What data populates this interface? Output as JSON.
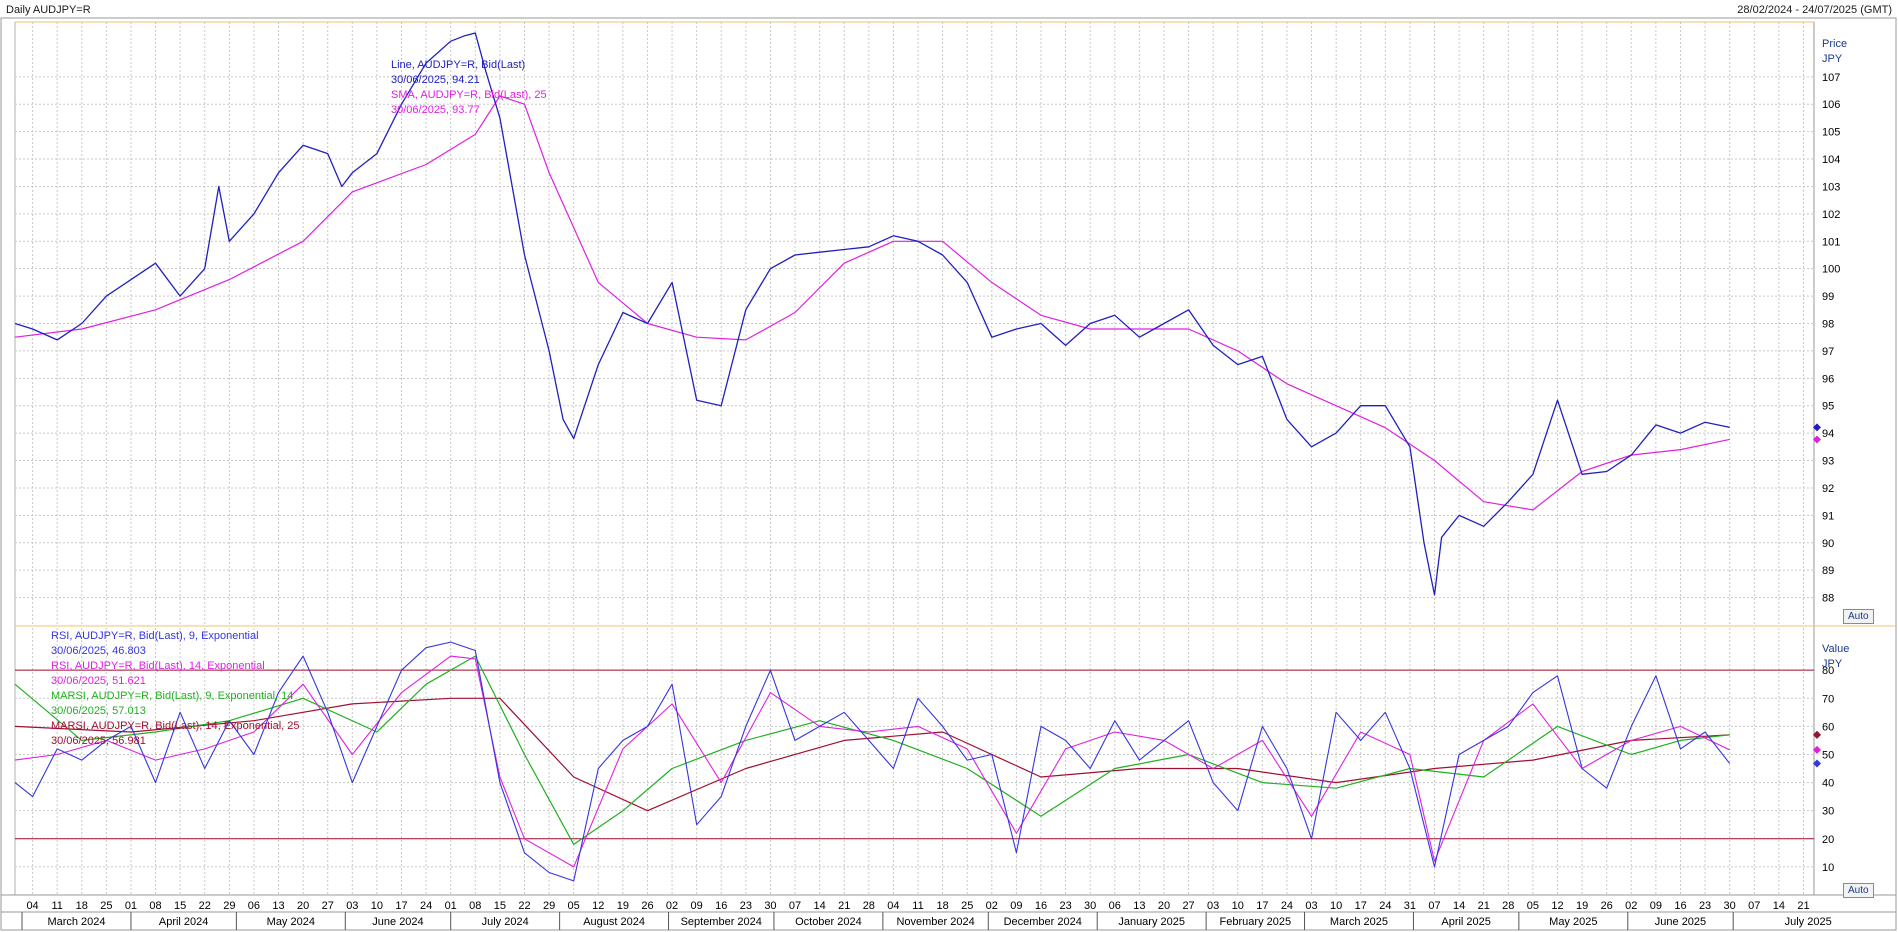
{
  "header": {
    "symbol_title": "Daily AUDJPY=R",
    "date_range": "28/02/2024 - 24/07/2025 (GMT)"
  },
  "controls": {
    "auto_label_price": "Auto",
    "auto_label_value": "Auto"
  },
  "colors": {
    "price_line": "#2020c0",
    "sma": "#e020e0",
    "rsi9": "#3535e0",
    "rsi14": "#e020e0",
    "marsi9": "#20b020",
    "marsi14": "#a01030",
    "band_line": "#a01030",
    "price_marker": "#2020c0",
    "sma_marker": "#e020e0",
    "frame_top": "#f0c070",
    "grid": "#c8c8c8"
  },
  "chart_data": [
    {
      "type": "line",
      "title": "Daily AUDJPY=R",
      "ylabel": "Price",
      "yunit": "JPY",
      "ylim": [
        87.0,
        109.0
      ],
      "yticks": [
        88,
        89,
        90,
        91,
        92,
        93,
        94,
        95,
        96,
        97,
        98,
        99,
        100,
        101,
        102,
        103,
        104,
        105,
        106,
        107
      ],
      "grid": true,
      "legend": [
        {
          "name": "Line, AUDJPY=R, Bid(Last)",
          "date": "30/06/2025",
          "value": "94.21"
        },
        {
          "name": "SMA, AUDJPY=R, Bid(Last),  25",
          "date": "30/06/2025",
          "value": "93.77"
        }
      ],
      "series": [
        {
          "name": "Line, AUDJPY=R, Bid(Last)",
          "x": [
            "2024-02-28",
            "2024-03-04",
            "2024-03-11",
            "2024-03-18",
            "2024-03-25",
            "2024-04-01",
            "2024-04-08",
            "2024-04-15",
            "2024-04-22",
            "2024-04-26",
            "2024-04-29",
            "2024-05-06",
            "2024-05-13",
            "2024-05-20",
            "2024-05-27",
            "2024-05-31",
            "2024-06-03",
            "2024-06-10",
            "2024-06-17",
            "2024-06-24",
            "2024-07-01",
            "2024-07-05",
            "2024-07-08",
            "2024-07-11",
            "2024-07-15",
            "2024-07-22",
            "2024-07-29",
            "2024-08-02",
            "2024-08-05",
            "2024-08-12",
            "2024-08-19",
            "2024-08-26",
            "2024-09-02",
            "2024-09-09",
            "2024-09-16",
            "2024-09-23",
            "2024-09-30",
            "2024-10-07",
            "2024-10-14",
            "2024-10-21",
            "2024-10-28",
            "2024-11-04",
            "2024-11-11",
            "2024-11-18",
            "2024-11-25",
            "2024-12-02",
            "2024-12-09",
            "2024-12-16",
            "2024-12-23",
            "2024-12-30",
            "2025-01-06",
            "2025-01-13",
            "2025-01-20",
            "2025-01-27",
            "2025-02-03",
            "2025-02-10",
            "2025-02-17",
            "2025-02-24",
            "2025-03-03",
            "2025-03-10",
            "2025-03-17",
            "2025-03-24",
            "2025-03-31",
            "2025-04-04",
            "2025-04-07",
            "2025-04-09",
            "2025-04-14",
            "2025-04-21",
            "2025-04-28",
            "2025-05-05",
            "2025-05-12",
            "2025-05-19",
            "2025-05-26",
            "2025-06-02",
            "2025-06-09",
            "2025-06-16",
            "2025-06-23",
            "2025-06-30"
          ],
          "values": [
            98.0,
            97.8,
            97.4,
            98.0,
            99.0,
            99.6,
            100.2,
            99.0,
            100.0,
            103.0,
            101.0,
            102.0,
            103.5,
            104.5,
            104.2,
            103.0,
            103.5,
            104.2,
            106.0,
            107.5,
            108.3,
            108.5,
            108.6,
            107.2,
            105.5,
            100.5,
            97.0,
            94.5,
            93.8,
            96.5,
            98.4,
            98.0,
            99.5,
            95.2,
            95.0,
            98.5,
            100.0,
            100.5,
            100.6,
            100.7,
            100.8,
            101.2,
            101.0,
            100.5,
            99.5,
            97.5,
            97.8,
            98.0,
            97.2,
            98.0,
            98.3,
            97.5,
            98.0,
            98.5,
            97.2,
            96.5,
            96.8,
            94.5,
            93.5,
            94.0,
            95.0,
            95.0,
            93.5,
            90.0,
            88.1,
            90.2,
            91.0,
            90.6,
            91.5,
            92.5,
            95.2,
            92.5,
            92.6,
            93.2,
            94.3,
            94.0,
            94.4,
            94.21
          ]
        },
        {
          "name": "SMA, AUDJPY=R, Bid(Last),  25",
          "x": [
            "2024-02-28",
            "2024-03-18",
            "2024-04-08",
            "2024-04-29",
            "2024-05-20",
            "2024-06-03",
            "2024-06-24",
            "2024-07-08",
            "2024-07-15",
            "2024-07-22",
            "2024-07-29",
            "2024-08-12",
            "2024-08-26",
            "2024-09-09",
            "2024-09-23",
            "2024-10-07",
            "2024-10-21",
            "2024-11-04",
            "2024-11-18",
            "2024-12-02",
            "2024-12-16",
            "2024-12-30",
            "2025-01-13",
            "2025-01-27",
            "2025-02-10",
            "2025-02-24",
            "2025-03-10",
            "2025-03-24",
            "2025-04-07",
            "2025-04-21",
            "2025-05-05",
            "2025-05-19",
            "2025-06-02",
            "2025-06-16",
            "2025-06-30"
          ],
          "values": [
            97.5,
            97.8,
            98.5,
            99.6,
            101.0,
            102.8,
            103.8,
            104.9,
            106.3,
            106.0,
            103.5,
            99.5,
            98.0,
            97.5,
            97.4,
            98.4,
            100.2,
            101.0,
            101.0,
            99.5,
            98.3,
            97.8,
            97.8,
            97.8,
            97.0,
            95.8,
            95.0,
            94.2,
            93.0,
            91.5,
            91.2,
            92.6,
            93.2,
            93.4,
            93.77
          ]
        }
      ]
    },
    {
      "type": "line",
      "title": "",
      "ylabel": "Value",
      "yunit": "JPY",
      "ylim": [
        0,
        95
      ],
      "yticks": [
        10,
        20,
        30,
        40,
        50,
        60,
        70,
        80
      ],
      "reference_lines": [
        20,
        80
      ],
      "grid": true,
      "legend": [
        {
          "name": "RSI, AUDJPY=R, Bid(Last),  9, Exponential",
          "date": "30/06/2025",
          "value": "46.803"
        },
        {
          "name": "RSI, AUDJPY=R, Bid(Last),  14, Exponential",
          "date": "30/06/2025",
          "value": "51.621"
        },
        {
          "name": "MARSI, AUDJPY=R, Bid(Last),  9, Exponential, 14",
          "date": "30/06/2025",
          "value": "57.013"
        },
        {
          "name": "MARSI, AUDJPY=R, Bid(Last),  14, Exponential, 25",
          "date": "30/06/2025",
          "value": "56.981"
        }
      ],
      "series": [
        {
          "name": "RSI, AUDJPY=R, Bid(Last),  9, Exponential",
          "x": [
            "2024-02-28",
            "2024-03-04",
            "2024-03-11",
            "2024-03-18",
            "2024-03-25",
            "2024-04-01",
            "2024-04-08",
            "2024-04-15",
            "2024-04-22",
            "2024-04-29",
            "2024-05-06",
            "2024-05-13",
            "2024-05-20",
            "2024-05-27",
            "2024-06-03",
            "2024-06-10",
            "2024-06-17",
            "2024-06-24",
            "2024-07-01",
            "2024-07-08",
            "2024-07-15",
            "2024-07-22",
            "2024-07-29",
            "2024-08-05",
            "2024-08-12",
            "2024-08-19",
            "2024-08-26",
            "2024-09-02",
            "2024-09-09",
            "2024-09-16",
            "2024-09-23",
            "2024-09-30",
            "2024-10-07",
            "2024-10-14",
            "2024-10-21",
            "2024-10-28",
            "2024-11-04",
            "2024-11-11",
            "2024-11-18",
            "2024-11-25",
            "2024-12-02",
            "2024-12-09",
            "2024-12-16",
            "2024-12-23",
            "2024-12-30",
            "2025-01-06",
            "2025-01-13",
            "2025-01-20",
            "2025-01-27",
            "2025-02-03",
            "2025-02-10",
            "2025-02-17",
            "2025-02-24",
            "2025-03-03",
            "2025-03-10",
            "2025-03-17",
            "2025-03-24",
            "2025-03-31",
            "2025-04-07",
            "2025-04-14",
            "2025-04-21",
            "2025-04-28",
            "2025-05-05",
            "2025-05-12",
            "2025-05-19",
            "2025-05-26",
            "2025-06-02",
            "2025-06-09",
            "2025-06-16",
            "2025-06-23",
            "2025-06-30"
          ],
          "values": [
            40,
            35,
            52,
            48,
            55,
            60,
            40,
            65,
            45,
            62,
            50,
            72,
            85,
            65,
            40,
            60,
            80,
            88,
            90,
            87,
            40,
            15,
            8,
            5,
            45,
            55,
            60,
            75,
            25,
            35,
            60,
            80,
            55,
            60,
            65,
            55,
            45,
            70,
            60,
            48,
            50,
            15,
            60,
            55,
            45,
            62,
            48,
            55,
            62,
            40,
            30,
            60,
            45,
            20,
            65,
            55,
            65,
            45,
            10,
            50,
            55,
            60,
            72,
            78,
            45,
            38,
            60,
            78,
            52,
            58,
            46.803
          ]
        },
        {
          "name": "RSI, AUDJPY=R, Bid(Last),  14, Exponential",
          "x": [
            "2024-02-28",
            "2024-03-11",
            "2024-03-25",
            "2024-04-08",
            "2024-04-22",
            "2024-05-06",
            "2024-05-20",
            "2024-06-03",
            "2024-06-17",
            "2024-07-01",
            "2024-07-08",
            "2024-07-15",
            "2024-07-22",
            "2024-08-05",
            "2024-08-19",
            "2024-09-02",
            "2024-09-16",
            "2024-09-30",
            "2024-10-14",
            "2024-10-28",
            "2024-11-11",
            "2024-11-25",
            "2024-12-09",
            "2024-12-23",
            "2025-01-06",
            "2025-01-20",
            "2025-02-03",
            "2025-02-17",
            "2025-03-03",
            "2025-03-17",
            "2025-03-31",
            "2025-04-07",
            "2025-04-21",
            "2025-05-05",
            "2025-05-19",
            "2025-06-02",
            "2025-06-16",
            "2025-06-30"
          ],
          "values": [
            48,
            50,
            55,
            48,
            52,
            58,
            75,
            50,
            72,
            85,
            84,
            42,
            20,
            10,
            52,
            68,
            40,
            72,
            60,
            58,
            60,
            52,
            22,
            52,
            58,
            55,
            45,
            55,
            28,
            58,
            50,
            12,
            55,
            68,
            45,
            55,
            60,
            51.621
          ]
        },
        {
          "name": "MARSI, AUDJPY=R, Bid(Last),  9, Exponential, 14",
          "x": [
            "2024-02-28",
            "2024-03-18",
            "2024-04-08",
            "2024-04-29",
            "2024-05-20",
            "2024-06-10",
            "2024-06-24",
            "2024-07-08",
            "2024-07-22",
            "2024-08-05",
            "2024-08-19",
            "2024-09-02",
            "2024-09-23",
            "2024-10-14",
            "2024-11-04",
            "2024-11-25",
            "2024-12-16",
            "2025-01-06",
            "2025-01-27",
            "2025-02-17",
            "2025-03-10",
            "2025-03-31",
            "2025-04-21",
            "2025-05-12",
            "2025-06-02",
            "2025-06-16",
            "2025-06-30"
          ],
          "values": [
            75,
            55,
            58,
            62,
            70,
            58,
            75,
            85,
            50,
            18,
            30,
            45,
            55,
            62,
            55,
            45,
            28,
            45,
            50,
            40,
            38,
            45,
            42,
            60,
            50,
            55,
            57.013
          ]
        },
        {
          "name": "MARSI, AUDJPY=R, Bid(Last),  14, Exponential, 25",
          "x": [
            "2024-02-28",
            "2024-04-01",
            "2024-05-06",
            "2024-06-03",
            "2024-07-01",
            "2024-07-15",
            "2024-08-05",
            "2024-08-26",
            "2024-09-23",
            "2024-10-21",
            "2024-11-18",
            "2024-12-16",
            "2025-01-13",
            "2025-02-10",
            "2025-03-10",
            "2025-04-07",
            "2025-05-05",
            "2025-06-02",
            "2025-06-30"
          ],
          "values": [
            60,
            58,
            62,
            68,
            70,
            70,
            42,
            30,
            45,
            55,
            58,
            42,
            45,
            45,
            40,
            45,
            48,
            55,
            56.981
          ]
        }
      ]
    }
  ],
  "x_axis": {
    "day_ticks": [
      "04",
      "11",
      "18",
      "25",
      "01",
      "08",
      "15",
      "22",
      "29",
      "06",
      "13",
      "20",
      "27",
      "03",
      "10",
      "17",
      "24",
      "01",
      "08",
      "15",
      "22",
      "29",
      "05",
      "12",
      "19",
      "26",
      "02",
      "09",
      "16",
      "23",
      "30",
      "07",
      "14",
      "21",
      "28",
      "04",
      "11",
      "18",
      "25",
      "02",
      "09",
      "16",
      "23",
      "30",
      "06",
      "13",
      "20",
      "27",
      "03",
      "10",
      "17",
      "24",
      "03",
      "10",
      "17",
      "24",
      "31",
      "07",
      "14",
      "21",
      "28",
      "05",
      "12",
      "19",
      "26",
      "02",
      "09",
      "16",
      "23",
      "30",
      "07",
      "14",
      "21"
    ],
    "day_tick_dates": [
      "2024-03-04",
      "2024-03-11",
      "2024-03-18",
      "2024-03-25",
      "2024-04-01",
      "2024-04-08",
      "2024-04-15",
      "2024-04-22",
      "2024-04-29",
      "2024-05-06",
      "2024-05-13",
      "2024-05-20",
      "2024-05-27",
      "2024-06-03",
      "2024-06-10",
      "2024-06-17",
      "2024-06-24",
      "2024-07-01",
      "2024-07-08",
      "2024-07-15",
      "2024-07-22",
      "2024-07-29",
      "2024-08-05",
      "2024-08-12",
      "2024-08-19",
      "2024-08-26",
      "2024-09-02",
      "2024-09-09",
      "2024-09-16",
      "2024-09-23",
      "2024-09-30",
      "2024-10-07",
      "2024-10-14",
      "2024-10-21",
      "2024-10-28",
      "2024-11-04",
      "2024-11-11",
      "2024-11-18",
      "2024-11-25",
      "2024-12-02",
      "2024-12-09",
      "2024-12-16",
      "2024-12-23",
      "2024-12-30",
      "2025-01-06",
      "2025-01-13",
      "2025-01-20",
      "2025-01-27",
      "2025-02-03",
      "2025-02-10",
      "2025-02-17",
      "2025-02-24",
      "2025-03-03",
      "2025-03-10",
      "2025-03-17",
      "2025-03-24",
      "2025-03-31",
      "2025-04-07",
      "2025-04-14",
      "2025-04-21",
      "2025-04-28",
      "2025-05-05",
      "2025-05-12",
      "2025-05-19",
      "2025-05-26",
      "2025-06-02",
      "2025-06-09",
      "2025-06-16",
      "2025-06-23",
      "2025-06-30",
      "2025-07-07",
      "2025-07-14",
      "2025-07-21"
    ],
    "months": [
      "March 2024",
      "April 2024",
      "May 2024",
      "June 2024",
      "July 2024",
      "August 2024",
      "September 2024",
      "October 2024",
      "November 2024",
      "December 2024",
      "January 2025",
      "February 2025",
      "March 2025",
      "April 2025",
      "May 2025",
      "June 2025",
      "July 2025"
    ],
    "month_dates": [
      "2024-03-01",
      "2024-04-01",
      "2024-05-01",
      "2024-06-01",
      "2024-07-01",
      "2024-08-01",
      "2024-09-01",
      "2024-10-01",
      "2024-11-01",
      "2024-12-01",
      "2025-01-01",
      "2025-02-01",
      "2025-03-01",
      "2025-04-01",
      "2025-05-01",
      "2025-06-01",
      "2025-07-01"
    ],
    "range": [
      "2024-02-28",
      "2025-07-24"
    ]
  }
}
